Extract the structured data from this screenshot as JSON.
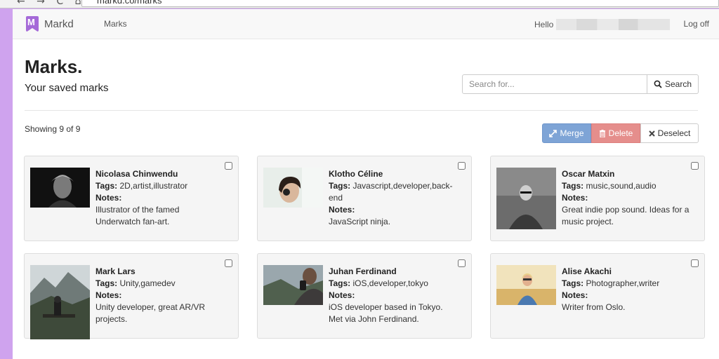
{
  "browser": {
    "url": "markd.co/marks",
    "nav_glyphs": "← → C ⌂"
  },
  "navbar": {
    "brand_letter": "M",
    "brand": "Markd",
    "marks_link": "Marks",
    "hello": "Hello",
    "logoff": "Log off"
  },
  "page": {
    "title": "Marks.",
    "subtitle": "Your saved marks"
  },
  "search": {
    "placeholder": "Search for...",
    "button": "Search"
  },
  "showing": "Showing 9 of 9",
  "actions": {
    "merge": "Merge",
    "delete": "Delete",
    "deselect": "Deselect"
  },
  "labels": {
    "tags": "Tags:",
    "notes": "Notes:"
  },
  "cards": [
    {
      "name": "Nicolasa Chinwendu",
      "tags": "2D,artist,illustrator",
      "notes": "Illustrator of the famed Underwatch fan-art."
    },
    {
      "name": "Klotho Céline",
      "tags": "Javascript,developer,back-end",
      "notes": "JavaScript ninja."
    },
    {
      "name": "Oscar Matxin",
      "tags": "music,sound,audio",
      "notes": "Great indie pop sound. Ideas for a music project."
    },
    {
      "name": "Mark Lars",
      "tags": "Unity,gamedev",
      "notes": "Unity developer, great AR/VR projects."
    },
    {
      "name": "Juhan Ferdinand",
      "tags": "iOS,developer,tokyo",
      "notes": "iOS developer based in Tokyo. Met via John Ferdinand."
    },
    {
      "name": "Alise Akachi",
      "tags": "Photographer,writer",
      "notes": "Writer from Oslo."
    }
  ]
}
